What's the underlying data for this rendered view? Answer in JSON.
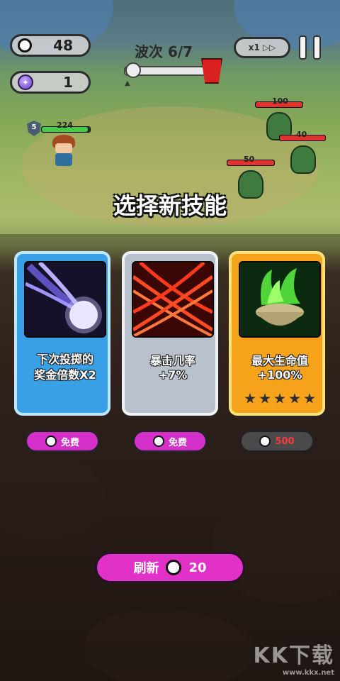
{
  "hud": {
    "coins": "48",
    "gems": "1",
    "wave_label": "波次 6/7",
    "wave_progress": 0.05,
    "speed_label": "x1"
  },
  "battlefield": {
    "hero_level": "5",
    "hero_hp": "224",
    "enemies": [
      {
        "hp": "100"
      },
      {
        "hp": "40"
      },
      {
        "hp": "50"
      }
    ]
  },
  "prompt": "选择新技能",
  "cards": [
    {
      "name_line1": "下次投掷的",
      "name_line2": "奖金倍数X2",
      "cost": "免费",
      "stars": 0
    },
    {
      "name_line1": "暴击几率",
      "name_line2": "+7%",
      "cost": "免费",
      "stars": 0
    },
    {
      "name_line1": "最大生命值",
      "name_line2": "+100%",
      "cost": "500",
      "stars": 5
    }
  ],
  "refresh": {
    "label": "刷新",
    "cost": "20"
  },
  "watermark": {
    "brand": "KK下载",
    "url": "www.kkx.net"
  },
  "colors": {
    "card1": "#3aa0e6",
    "card2": "#b9c2cc",
    "card3": "#f7a21b",
    "button_free": "#d42fc9",
    "button_paid": "#4a4a4a",
    "refresh": "#e231c9"
  }
}
